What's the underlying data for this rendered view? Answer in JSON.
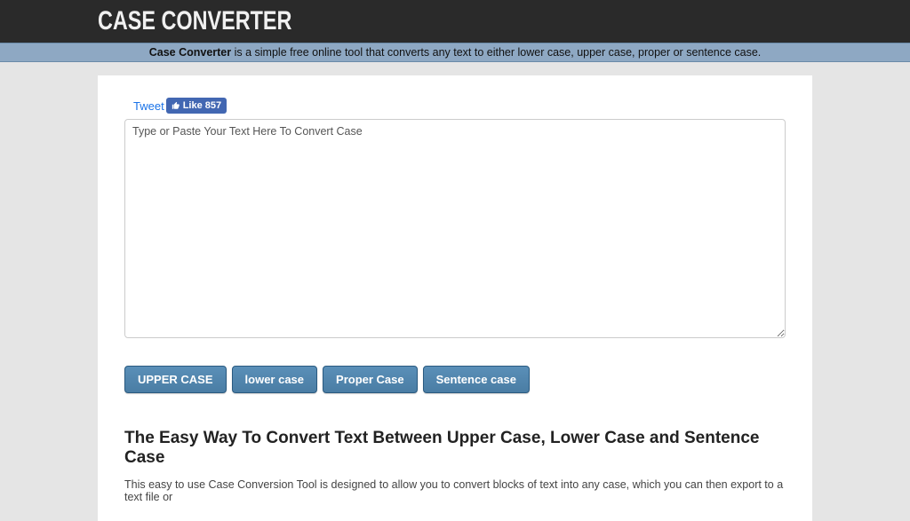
{
  "header": {
    "title": "CASE CONVERTER",
    "tagline_bold": "Case Converter",
    "tagline_rest": " is a simple free online tool that converts any text to either lower case, upper case, proper or sentence case."
  },
  "social": {
    "tweet_label": "Tweet",
    "fb_like_label": "Like",
    "fb_like_count": "857"
  },
  "textarea": {
    "placeholder": "Type or Paste Your Text Here To Convert Case"
  },
  "buttons": {
    "upper": "UPPER CASE",
    "lower": "lower case",
    "proper": "Proper Case",
    "sentence": "Sentence case"
  },
  "article": {
    "heading": "The Easy Way To Convert Text Between Upper Case, Lower Case and Sentence Case",
    "body_partial": "This easy to use Case Conversion Tool is designed to allow you to convert blocks of text into any case, which you can then export to a text file or"
  }
}
